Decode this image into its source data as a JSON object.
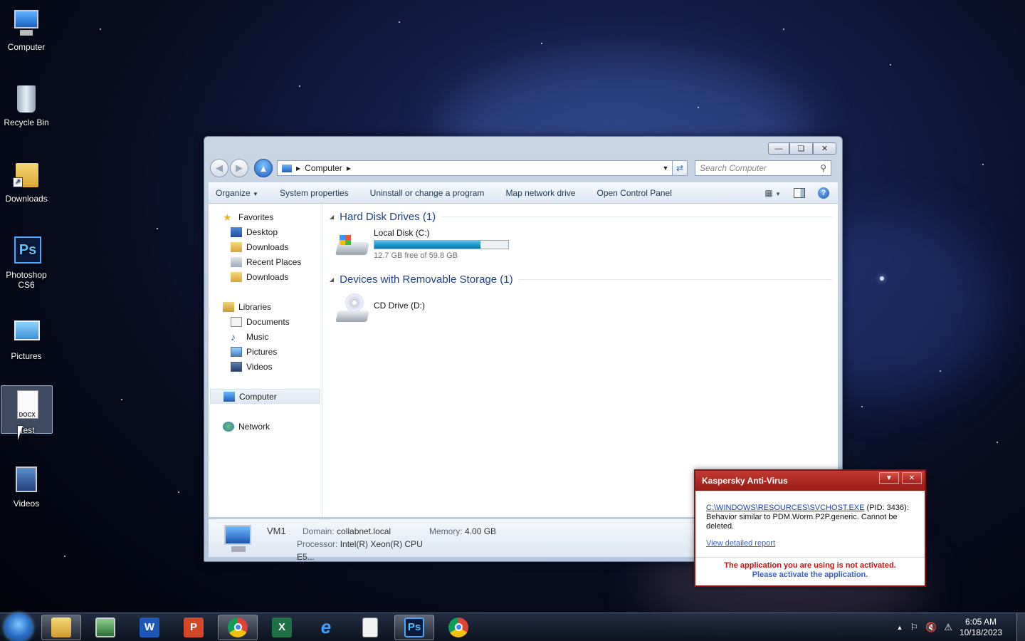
{
  "desktop": {
    "icons": [
      {
        "label": "Computer"
      },
      {
        "label": "Recycle Bin"
      },
      {
        "label": "Downloads"
      },
      {
        "label": "Photoshop CS6"
      },
      {
        "label": "Pictures"
      },
      {
        "label": "Test",
        "badge": "DOCX"
      },
      {
        "label": "Videos"
      }
    ]
  },
  "explorer": {
    "address": "Computer",
    "search_placeholder": "Search Computer",
    "toolbar": {
      "organize": "Organize",
      "system_properties": "System properties",
      "uninstall": "Uninstall or change a program",
      "map_drive": "Map network drive",
      "control_panel": "Open Control Panel"
    },
    "nav": {
      "favorites": "Favorites",
      "desktop": "Desktop",
      "downloads": "Downloads",
      "recent": "Recent Places",
      "downloads2": "Downloads",
      "libraries": "Libraries",
      "documents": "Documents",
      "music": "Music",
      "pictures": "Pictures",
      "videos": "Videos",
      "computer": "Computer",
      "network": "Network"
    },
    "groups": {
      "hdd": "Hard Disk Drives (1)",
      "removable": "Devices with Removable Storage (1)"
    },
    "drives": {
      "c_name": "Local Disk (C:)",
      "c_free": "12.7 GB free of 59.8 GB",
      "c_used_fraction": 0.79,
      "d_name": "CD Drive (D:)"
    },
    "details": {
      "name": "VM1",
      "domain_label": "Domain:",
      "domain": "collabnet.local",
      "memory_label": "Memory:",
      "memory": "4.00 GB",
      "processor_label": "Processor:",
      "processor": "Intel(R) Xeon(R) CPU E5..."
    }
  },
  "kaspersky": {
    "title": "Kaspersky Anti-Virus",
    "path": "C:\\WINDOWS\\RESOURCES\\SVCHOST.EXE",
    "pid": "(PID: 3436):",
    "message": "Behavior similar to PDM.Worm.P2P.generic. Cannot be deleted.",
    "report_link": "View detailed report",
    "not_activated": "The application you are using is not activated.",
    "activate": "Please activate the application."
  },
  "taskbar": {
    "time": "6:05 AM",
    "date": "10/18/2023"
  }
}
